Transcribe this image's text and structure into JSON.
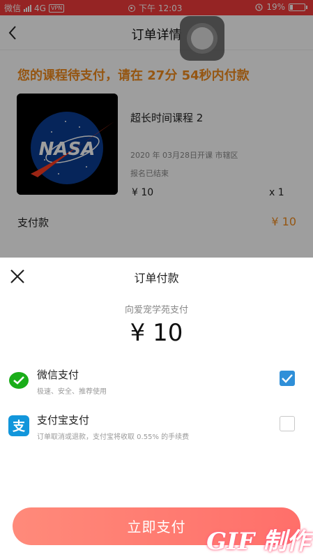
{
  "status_bar": {
    "carrier": "微信",
    "network": "4G",
    "vpn": "VPN",
    "time": "下午 12:03",
    "battery": "19%"
  },
  "header": {
    "title": "订单详情"
  },
  "order": {
    "warning": "您的课程待支付，请在 27分 54秒内付款",
    "course_thumb_text": "NASA",
    "course_name": "超长时间课程 2",
    "course_meta": "2020 年 03月28日开课 市辖区",
    "course_status": "报名已结束",
    "price": "¥ 10",
    "quantity": "x 1",
    "amount_label": "支付款",
    "amount_value": "¥ 10"
  },
  "payment_sheet": {
    "title": "订单付款",
    "payee": "向爱宠学苑支付",
    "amount": "¥ 10",
    "methods": [
      {
        "name": "微信支付",
        "desc": "极速、安全、推荐使用",
        "icon": "wechat-pay-icon",
        "selected": true
      },
      {
        "name": "支付宝支付",
        "desc": "订单取消或退款，支付宝将收取 0.55% 的手续费",
        "icon": "alipay-icon",
        "selected": false
      }
    ],
    "pay_button": "立即支付"
  },
  "watermark": "GIF 制作",
  "colors": {
    "status_bar": "#f03a3a",
    "accent_orange": "#f08c1e",
    "checkbox_blue": "#2f8fd8",
    "wechat_green": "#1aad19",
    "alipay_blue": "#1296db",
    "pay_button": "#ff7a72"
  }
}
